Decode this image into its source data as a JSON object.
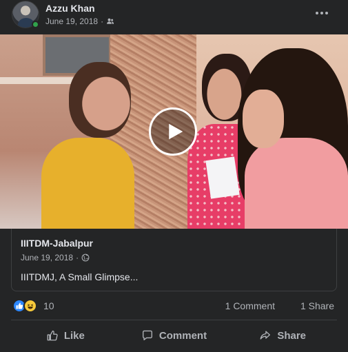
{
  "post": {
    "author": "Azzu Khan",
    "date": "June 19, 2018",
    "separator": "·",
    "audience_icon": "friends-icon",
    "menu_icon": "more-options-icon"
  },
  "video": {
    "play_icon": "play-icon"
  },
  "link_preview": {
    "title": "IIITDM-Jabalpur",
    "date": "June 19, 2018",
    "separator": "·",
    "audience_icon": "globe-icon",
    "text": "IIITDMJ, A Small Glimpse..."
  },
  "reactions": {
    "icons": [
      "like-reaction-icon",
      "haha-reaction-icon"
    ],
    "count": "10",
    "comments": "1 Comment",
    "shares": "1 Share"
  },
  "actions": {
    "like": "Like",
    "comment": "Comment",
    "share": "Share"
  },
  "colors": {
    "background": "#242526",
    "primary_text": "#e4e6eb",
    "secondary_text": "#b0b3b8",
    "like_blue": "#2d88ff",
    "online_green": "#31a24c"
  }
}
